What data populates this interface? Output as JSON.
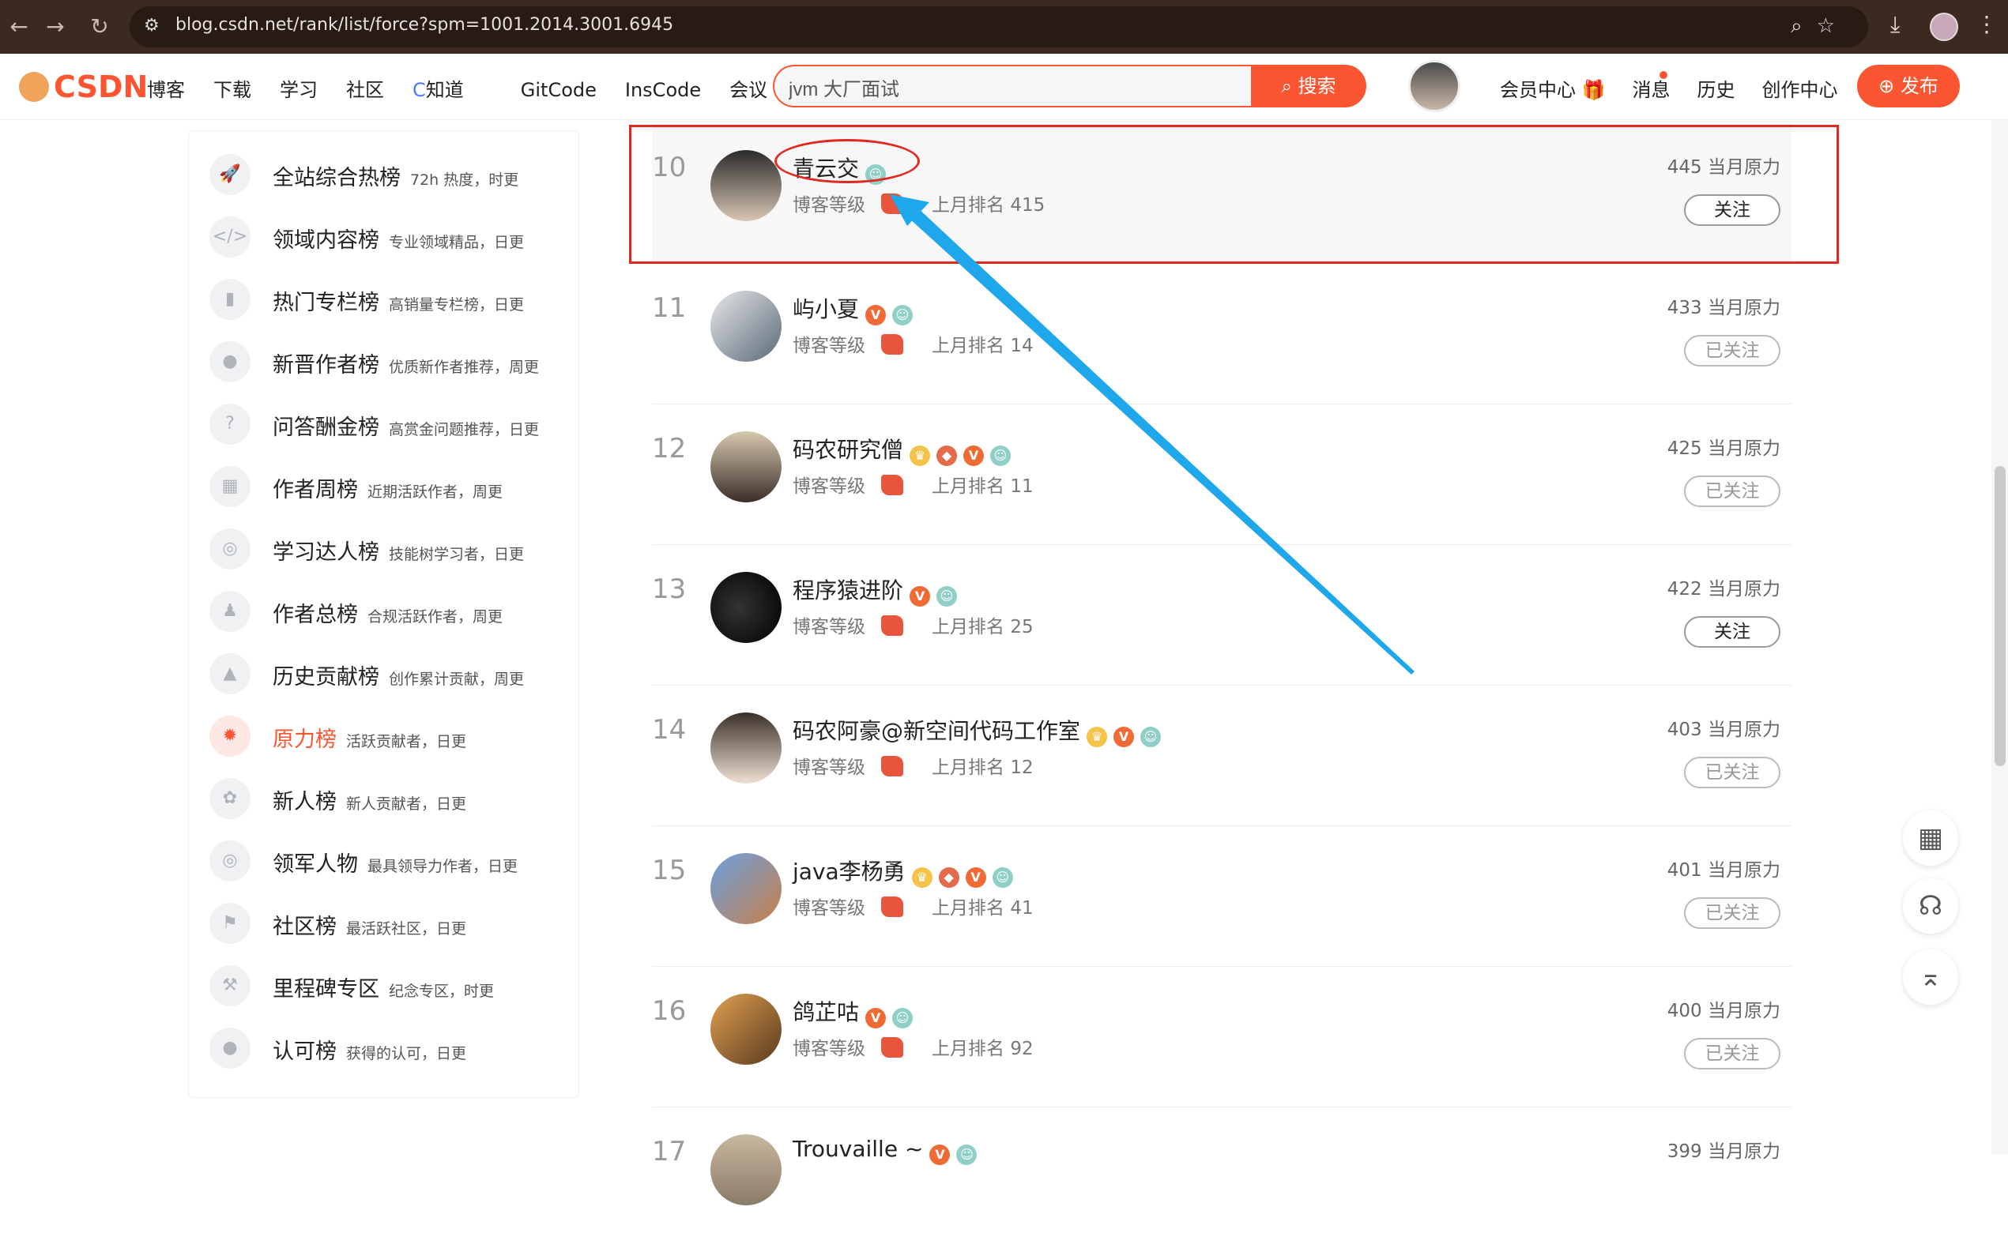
{
  "browser": {
    "url": "blog.csdn.net/rank/list/force?spm=1001.2014.3001.6945",
    "back_icon": "←",
    "forward_icon": "→",
    "reload_icon": "↻"
  },
  "header": {
    "logo": "CSDN",
    "nav": [
      "博客",
      "下载",
      "学习",
      "社区",
      "知道",
      "GitCode",
      "InsCode",
      "会议"
    ],
    "search_value": "jvm 大厂面试",
    "search_button": "搜索",
    "links": [
      "会员中心 🎁",
      "消息",
      "历史",
      "创作中心"
    ],
    "publish": "发布",
    "accent": "#fc5531"
  },
  "sidebar": {
    "items": [
      {
        "name": "全站综合热榜",
        "desc": "72h 热度，时更"
      },
      {
        "name": "领域内容榜",
        "desc": "专业领域精品，日更"
      },
      {
        "name": "热门专栏榜",
        "desc": "高销量专栏榜，日更"
      },
      {
        "name": "新晋作者榜",
        "desc": "优质新作者推荐，周更"
      },
      {
        "name": "问答酬金榜",
        "desc": "高赏金问题推荐，日更"
      },
      {
        "name": "作者周榜",
        "desc": "近期活跃作者，周更"
      },
      {
        "name": "学习达人榜",
        "desc": "技能树学习者，日更"
      },
      {
        "name": "作者总榜",
        "desc": "合规活跃作者，周更"
      },
      {
        "name": "历史贡献榜",
        "desc": "创作累计贡献，周更"
      },
      {
        "name": "原力榜",
        "desc": "活跃贡献者，日更"
      },
      {
        "name": "新人榜",
        "desc": "新人贡献者，日更"
      },
      {
        "name": "领军人物",
        "desc": "最具领导力作者，日更"
      },
      {
        "name": "社区榜",
        "desc": "最活跃社区，日更"
      },
      {
        "name": "里程碑专区",
        "desc": "纪念专区，时更"
      },
      {
        "name": "认可榜",
        "desc": "获得的认可，日更"
      }
    ]
  },
  "labels": {
    "level": "博客等级",
    "last_rank": "上月排名",
    "score_suffix": "当月原力"
  },
  "ranking": [
    {
      "rank": "10",
      "name": "青云交",
      "last": "415",
      "score": "445",
      "follow": "关注"
    },
    {
      "rank": "11",
      "name": "屿小夏",
      "last": "14",
      "score": "433",
      "follow": "已关注"
    },
    {
      "rank": "12",
      "name": "码农研究僧",
      "last": "11",
      "score": "425",
      "follow": "已关注"
    },
    {
      "rank": "13",
      "name": "程序猿进阶",
      "last": "25",
      "score": "422",
      "follow": "关注"
    },
    {
      "rank": "14",
      "name": "码农阿豪@新空间代码工作室",
      "last": "12",
      "score": "403",
      "follow": "已关注"
    },
    {
      "rank": "15",
      "name": "java李杨勇",
      "last": "41",
      "score": "401",
      "follow": "已关注"
    },
    {
      "rank": "16",
      "name": "鸽芷咕",
      "last": "92",
      "score": "400",
      "follow": "已关注"
    },
    {
      "rank": "17",
      "name": "Trouvaille ~",
      "last": "",
      "score": "399",
      "follow": ""
    }
  ]
}
